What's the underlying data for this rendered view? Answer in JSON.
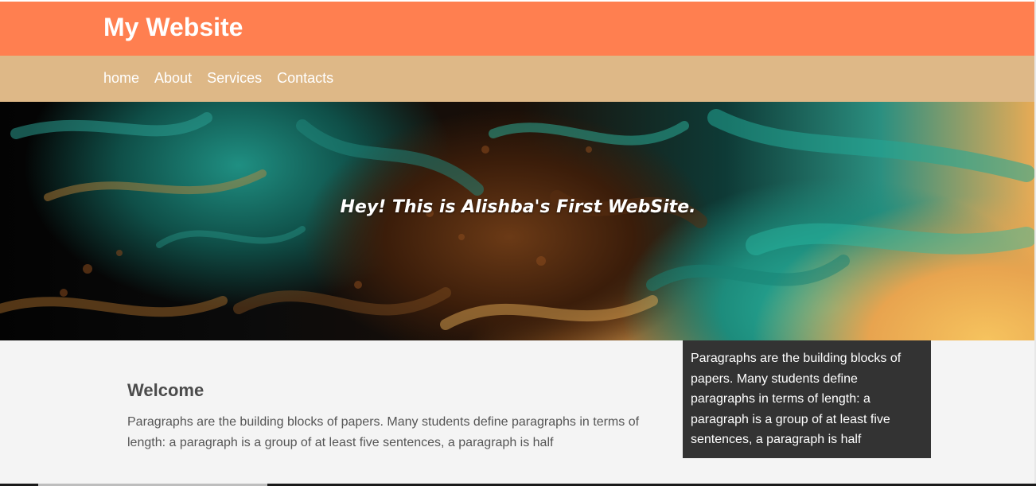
{
  "header": {
    "site_title": "My Website",
    "background_color": "#ff7f50"
  },
  "nav": {
    "background_color": "#deb887",
    "items": [
      {
        "label": "home"
      },
      {
        "label": "About"
      },
      {
        "label": "Services"
      },
      {
        "label": "Contacts"
      }
    ]
  },
  "hero": {
    "heading": "Hey! This is Alishba's First WebSite."
  },
  "main": {
    "heading": "Welcome",
    "paragraph": "Paragraphs are the building blocks of papers. Many students define paragraphs in terms of length: a paragraph is a group of at least five sentences, a paragraph is half"
  },
  "sidebar": {
    "paragraph": "Paragraphs are the building blocks of papers. Many students define paragraphs in terms of length: a paragraph is a group of at least five sentences, a paragraph is half",
    "background_color": "#333333"
  }
}
